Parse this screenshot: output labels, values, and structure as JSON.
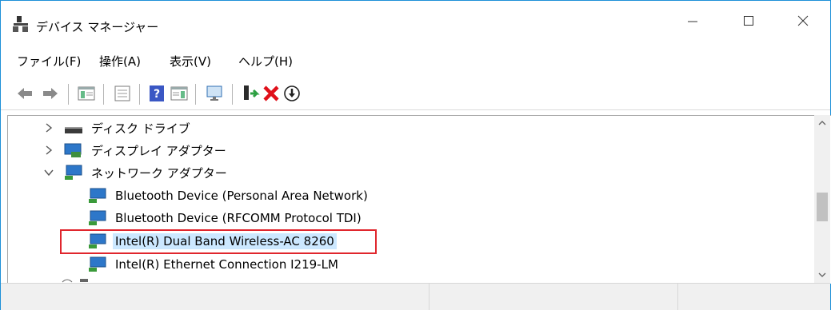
{
  "window": {
    "title": "デバイス マネージャー",
    "icons": {
      "app": "device-manager-icon",
      "minimize": "minimize-icon",
      "maximize": "maximize-icon",
      "close": "close-icon"
    }
  },
  "menu": [
    {
      "label": "ファイル(F)"
    },
    {
      "label": "操作(A)"
    },
    {
      "label": "表示(V)"
    },
    {
      "label": "ヘルプ(H)"
    }
  ],
  "toolbar": {
    "buttons": [
      "back-arrow-icon",
      "forward-arrow-icon",
      "show-hide-console-tree-icon",
      "properties-icon",
      "help-icon",
      "action-pane-icon",
      "scan-hardware-icon",
      "update-driver-icon",
      "uninstall-icon",
      "disable-device-icon"
    ]
  },
  "tree": {
    "items": [
      {
        "label": "ディスク ドライブ",
        "expanded": false,
        "icon": "disk-drive-icon"
      },
      {
        "label": "ディスプレイ アダプター",
        "expanded": false,
        "icon": "display-adapter-icon"
      },
      {
        "label": "ネットワーク アダプター",
        "expanded": true,
        "icon": "network-adapter-icon",
        "children": [
          {
            "label": "Bluetooth Device (Personal Area Network)"
          },
          {
            "label": "Bluetooth Device (RFCOMM Protocol TDI)"
          },
          {
            "label": "Intel(R) Dual Band Wireless-AC 8260",
            "selected": true,
            "highlighted": true
          },
          {
            "label": "Intel(R) Ethernet Connection I219-LM"
          }
        ]
      }
    ]
  },
  "colors": {
    "selection": "#cce8ff",
    "highlight_box": "#e0262d",
    "window_border": "#1e90d8"
  }
}
